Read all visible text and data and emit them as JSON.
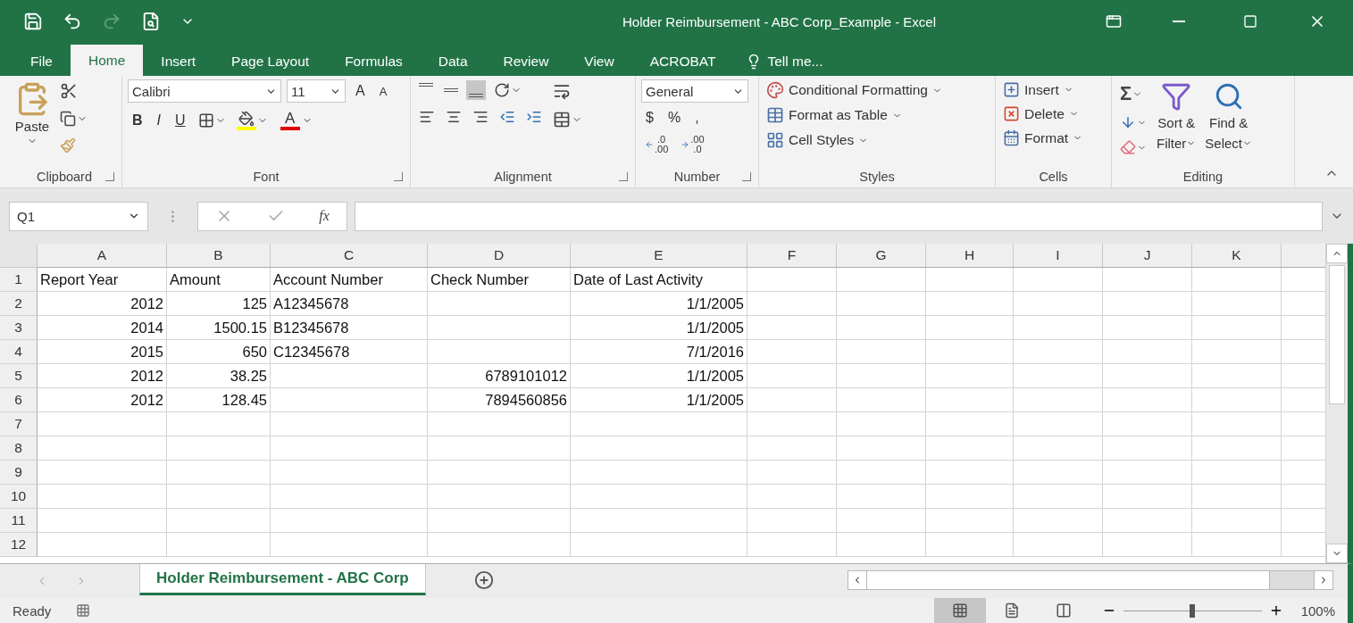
{
  "window": {
    "title": "Holder Reimbursement - ABC Corp_Example - Excel"
  },
  "ribbon_tabs": [
    {
      "label": "File",
      "selected": false
    },
    {
      "label": "Home",
      "selected": true
    },
    {
      "label": "Insert",
      "selected": false
    },
    {
      "label": "Page Layout",
      "selected": false
    },
    {
      "label": "Formulas",
      "selected": false
    },
    {
      "label": "Data",
      "selected": false
    },
    {
      "label": "Review",
      "selected": false
    },
    {
      "label": "View",
      "selected": false
    },
    {
      "label": "ACROBAT",
      "selected": false
    }
  ],
  "tell_me": "Tell me...",
  "clipboard": {
    "label": "Clipboard",
    "paste": "Paste"
  },
  "font": {
    "label": "Font",
    "name": "Calibri",
    "size": "11",
    "grow": "A",
    "shrink": "A",
    "styles": [
      {
        "kind": "bold",
        "text": "B"
      },
      {
        "kind": "italic",
        "text": "I"
      },
      {
        "kind": "underline",
        "text": "U"
      }
    ],
    "font_color_letter": "A"
  },
  "alignment": {
    "label": "Alignment",
    "vertical": [
      {
        "kind": "top",
        "selected": false
      },
      {
        "kind": "middle",
        "selected": false
      },
      {
        "kind": "bottom",
        "selected": true
      }
    ]
  },
  "number": {
    "label": "Number",
    "format": "General",
    "symbols": [
      "$",
      "%",
      ","
    ],
    "decimals": [
      {
        "kind": "increase",
        "top": ".0",
        "bottom": ".00"
      },
      {
        "kind": "decrease",
        "top": ".00",
        "bottom": ".0"
      }
    ]
  },
  "styles": {
    "label": "Styles",
    "items": [
      {
        "kind": "conditional",
        "text": "Conditional Formatting"
      },
      {
        "kind": "table",
        "text": "Format as Table"
      },
      {
        "kind": "cell",
        "text": "Cell Styles"
      }
    ]
  },
  "cells": {
    "label": "Cells",
    "items": [
      {
        "kind": "insert",
        "text": "Insert"
      },
      {
        "kind": "delete",
        "text": "Delete"
      },
      {
        "kind": "format",
        "text": "Format"
      }
    ]
  },
  "editing": {
    "label": "Editing",
    "sum": "Σ",
    "sort": [
      "Sort &",
      "Filter"
    ],
    "find": [
      "Find &",
      "Select"
    ]
  },
  "formula_bar": {
    "name_box": "Q1",
    "function_label": "fx"
  },
  "columns": [
    "A",
    "B",
    "C",
    "D",
    "E",
    "F",
    "G",
    "H",
    "I",
    "J",
    "K"
  ],
  "rows": [
    {
      "number": "1",
      "cells": [
        {
          "kind": "text",
          "text": "Report Year"
        },
        {
          "kind": "text",
          "text": "Amount"
        },
        {
          "kind": "text",
          "text": "Account Number"
        },
        {
          "kind": "text",
          "text": "Check Number"
        },
        {
          "kind": "text",
          "text": "Date of Last Activity"
        }
      ]
    },
    {
      "number": "2",
      "cells": [
        {
          "kind": "number",
          "text": "2012"
        },
        {
          "kind": "number",
          "text": "125"
        },
        {
          "kind": "text",
          "text": "A12345678"
        },
        null,
        {
          "kind": "number",
          "text": "1/1/2005"
        }
      ]
    },
    {
      "number": "3",
      "cells": [
        {
          "kind": "number",
          "text": "2014"
        },
        {
          "kind": "number",
          "text": "1500.15"
        },
        {
          "kind": "text",
          "text": "B12345678"
        },
        null,
        {
          "kind": "number",
          "text": "1/1/2005"
        }
      ]
    },
    {
      "number": "4",
      "cells": [
        {
          "kind": "number",
          "text": "2015"
        },
        {
          "kind": "number",
          "text": "650"
        },
        {
          "kind": "text",
          "text": "C12345678"
        },
        null,
        {
          "kind": "number",
          "text": "7/1/2016"
        }
      ]
    },
    {
      "number": "5",
      "cells": [
        {
          "kind": "number",
          "text": "2012"
        },
        {
          "kind": "number",
          "text": "38.25"
        },
        null,
        {
          "kind": "number",
          "text": "6789101012"
        },
        {
          "kind": "number",
          "text": "1/1/2005"
        }
      ]
    },
    {
      "number": "6",
      "cells": [
        {
          "kind": "number",
          "text": "2012"
        },
        {
          "kind": "number",
          "text": "128.45"
        },
        null,
        {
          "kind": "number",
          "text": "7894560856"
        },
        {
          "kind": "number",
          "text": "1/1/2005"
        }
      ]
    },
    {
      "number": "7"
    },
    {
      "number": "8"
    },
    {
      "number": "9"
    },
    {
      "number": "10"
    },
    {
      "number": "11"
    },
    {
      "number": "12"
    }
  ],
  "sheet_tabs": [
    {
      "label": "Holder Reimbursement - ABC Corp",
      "selected": true
    }
  ],
  "status_bar": {
    "status": "Ready",
    "views": [
      {
        "kind": "normal",
        "selected": true
      },
      {
        "kind": "page-layout",
        "selected": false
      },
      {
        "kind": "page-break",
        "selected": false
      }
    ],
    "zoom": {
      "level": 0.5,
      "reading": "100%"
    }
  }
}
